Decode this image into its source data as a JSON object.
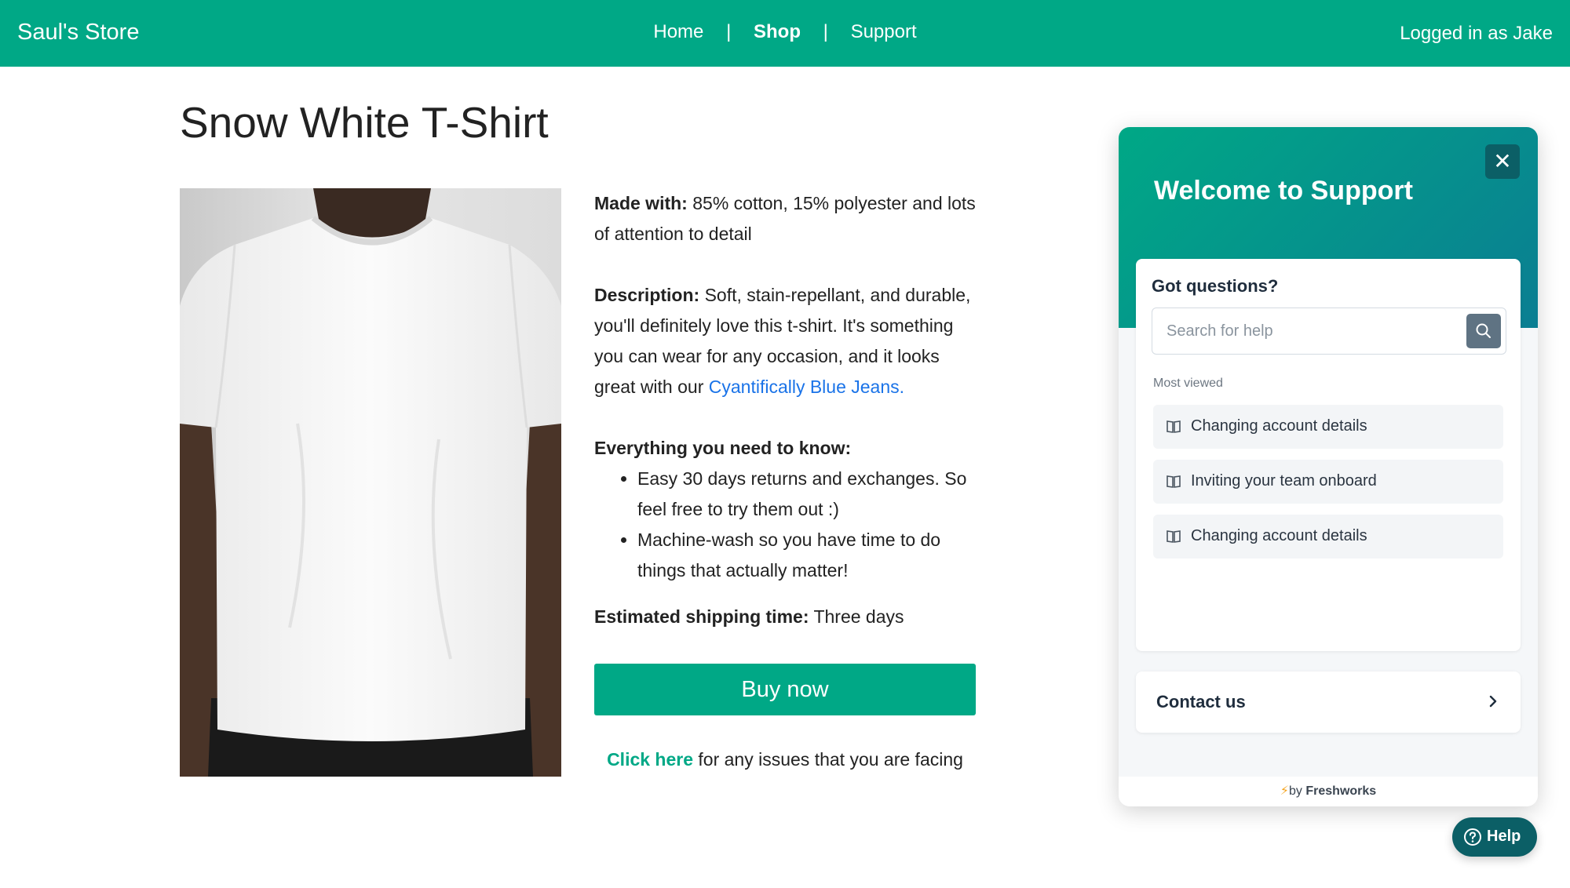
{
  "header": {
    "brand": "Saul's Store",
    "nav": [
      {
        "label": "Home"
      },
      {
        "label": "Shop",
        "active": true
      },
      {
        "label": "Support"
      }
    ],
    "separator": "|",
    "user_status": "Logged in as Jake"
  },
  "product": {
    "title": "Snow White T-Shirt",
    "made_with_label": "Made with:",
    "made_with_text": " 85% cotton, 15% polyester and lots of attention to detail",
    "description_label": "Description:",
    "description_text": " Soft, stain-repellant, and durable, you'll definitely love this t-shirt. It's something you can wear for any occasion, and it looks great with our ",
    "description_link": "Cyantifically Blue Jeans.",
    "know_label": "Everything you need to know:",
    "bullets": [
      "Easy 30 days returns and exchanges. So feel free to try them out :)",
      "Machine-wash so you have time to do things that actually matter!"
    ],
    "shipping_label": "Estimated shipping time:",
    "shipping_text": " Three days",
    "buy_label": "Buy now",
    "issues_link": "Click here",
    "issues_text": " for any issues that you are facing"
  },
  "support_widget": {
    "title": "Welcome to Support",
    "close_icon": "close-icon",
    "question": "Got questions?",
    "search_placeholder": "Search for help",
    "most_viewed_label": "Most viewed",
    "articles": [
      {
        "label": "Changing account details"
      },
      {
        "label": "Inviting your team onboard"
      },
      {
        "label": "Changing account details"
      }
    ],
    "contact_label": "Contact us",
    "footer_prefix": "by ",
    "footer_brand": "Freshworks"
  },
  "help_button": {
    "label": "Help"
  },
  "colors": {
    "brand_green": "#00a886",
    "widget_dark": "#0b5f66",
    "link_blue": "#1a73e8"
  }
}
